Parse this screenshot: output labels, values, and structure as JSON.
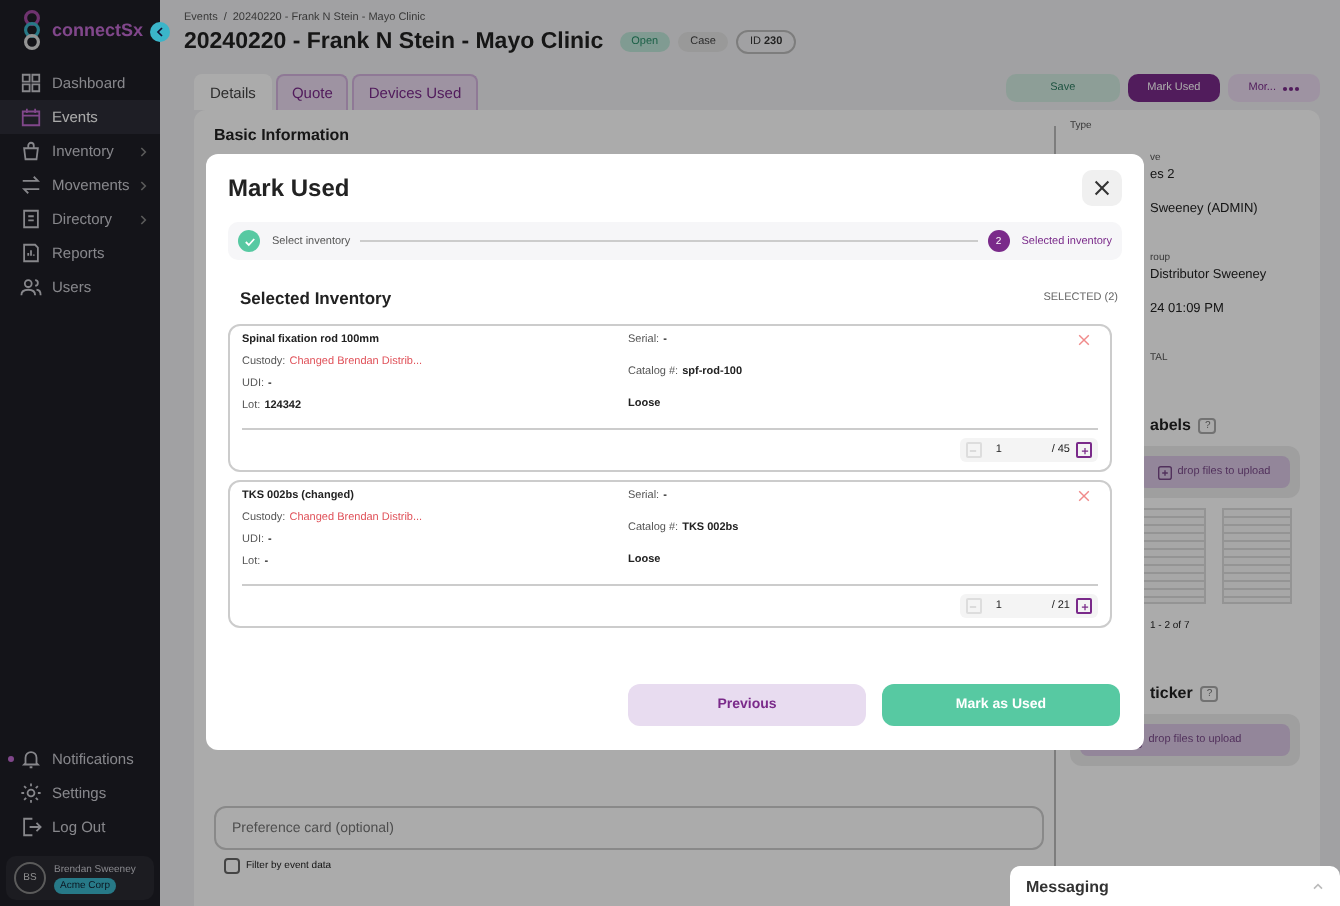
{
  "sidebar": {
    "logo": "connectSx",
    "nav": [
      {
        "label": "Dashboard",
        "selected": false,
        "submenu": false
      },
      {
        "label": "Events",
        "selected": true,
        "submenu": false
      },
      {
        "label": "Inventory",
        "selected": false,
        "submenu": true
      },
      {
        "label": "Movements",
        "selected": false,
        "submenu": true
      },
      {
        "label": "Directory",
        "selected": false,
        "submenu": true
      },
      {
        "label": "Reports",
        "selected": false,
        "submenu": false
      },
      {
        "label": "Users",
        "selected": false,
        "submenu": false
      }
    ],
    "footer": [
      {
        "label": "Notifications",
        "unread": true
      },
      {
        "label": "Settings",
        "unread": false
      },
      {
        "label": "Log Out",
        "unread": false
      }
    ],
    "user": {
      "initials": "BS",
      "name": "Brendan Sweeney",
      "org": "Acme Corp"
    }
  },
  "header": {
    "breadcrumb": [
      "Events",
      "20240220 - Frank N Stein - Mayo Clinic"
    ],
    "separator": "/",
    "title": "20240220 - Frank N Stein - Mayo Clinic",
    "badges": [
      {
        "text": "Open",
        "kind": "status"
      },
      {
        "text": "Case",
        "kind": "plain"
      },
      {
        "text": "ID **230**",
        "kind": "outline"
      }
    ]
  },
  "tabs": [
    {
      "label": "Details",
      "selected": true
    },
    {
      "label": "Quote",
      "selected": false
    },
    {
      "label": "Devices Used",
      "selected": false
    }
  ],
  "actions": [
    {
      "label": "Save",
      "kind": "secondary",
      "disabled": true
    },
    {
      "label": "Mark Used",
      "kind": "primary",
      "disabled": false
    },
    {
      "label": "Mor...",
      "kind": "more",
      "disabled": false
    }
  ],
  "details": {
    "heading": "Basic Information",
    "preference_field": {
      "placeholder": "Preference card (optional)"
    },
    "filter_checkbox": {
      "label": "Filter by event data",
      "checked": false
    }
  },
  "side_panel": [
    {
      "kind": "label",
      "text": "Type"
    },
    {
      "kind": "label",
      "text": "ve"
    },
    {
      "kind": "value",
      "text": "es 2"
    },
    {
      "kind": "value",
      "text": "Sweeney (ADMIN)"
    },
    {
      "kind": "label",
      "text": "roup"
    },
    {
      "kind": "value",
      "text": "Distributor Sweeney"
    },
    {
      "kind": "value",
      "text": "24 01:09 PM"
    },
    {
      "kind": "label",
      "text": "TAL"
    },
    {
      "kind": "heading",
      "text": "abels",
      "help": "?"
    },
    {
      "kind": "upload",
      "text": "drop files to upload"
    },
    {
      "kind": "thumbs"
    },
    {
      "kind": "pager",
      "text": "1 - 2 of 7"
    },
    {
      "kind": "heading",
      "text": "ticker",
      "help": "?"
    },
    {
      "kind": "upload",
      "text": "drop files to upload"
    }
  ],
  "modal": {
    "title": "Mark Used",
    "steps": [
      {
        "label": "Select inventory",
        "done": true
      },
      {
        "label": "Selected inventory",
        "number": "2",
        "done": false
      }
    ],
    "section_title": "Selected Inventory",
    "selected_count": "SELECTED (2)",
    "items": [
      {
        "name": "Spinal fixation rod 100mm",
        "left": [
          {
            "kind": "link",
            "label": "Custody:",
            "value": "Changed Brendan Distrib..."
          },
          {
            "kind": "plain",
            "text": "UDI: **-**"
          },
          {
            "kind": "plain",
            "text": "Lot: **124342**"
          }
        ],
        "right": [
          {
            "text": "Serial: **-**"
          },
          {
            "text": "Catalog #: **spf-rod-100**"
          }
        ],
        "packaging": "Loose",
        "quantity": "1",
        "max": "/ 45"
      },
      {
        "name": "TKS 002bs (changed)",
        "left": [
          {
            "kind": "link",
            "label": "Custody:",
            "value": "Changed Brendan Distrib..."
          },
          {
            "kind": "plain",
            "text": "UDI: **-**"
          },
          {
            "kind": "plain",
            "text": "Lot: **-**"
          }
        ],
        "right": [
          {
            "text": "Serial: **-**"
          },
          {
            "text": "Catalog #: **TKS 002bs**"
          }
        ],
        "packaging": "Loose",
        "quantity": "1",
        "max": "/ 21"
      }
    ],
    "buttons": [
      {
        "label": "Previous",
        "kind": "secondary"
      },
      {
        "label": "Mark as Used",
        "kind": "primary"
      }
    ]
  },
  "messaging": {
    "title": "Messaging"
  }
}
